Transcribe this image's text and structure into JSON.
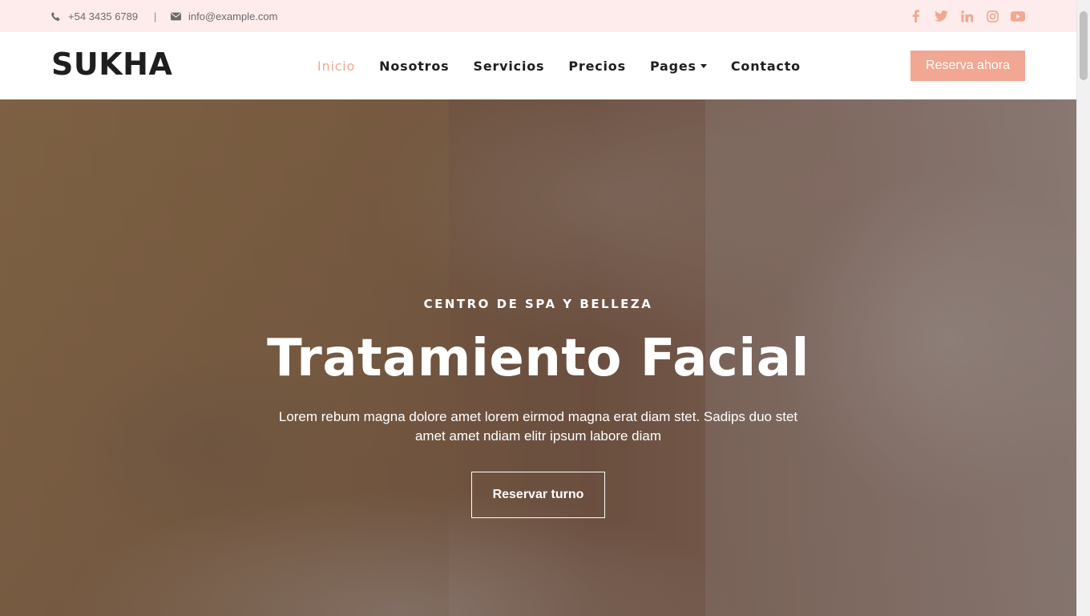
{
  "topbar": {
    "phone": "+54 3435 6789",
    "separator": "|",
    "email": "info@example.com",
    "phone_icon": "phone-icon",
    "email_icon": "envelope-icon",
    "socials": [
      "facebook-icon",
      "twitter-icon",
      "linkedin-icon",
      "instagram-icon",
      "youtube-icon"
    ],
    "accent": "#f2a793",
    "background": "#fdeceb"
  },
  "navbar": {
    "brand": "SUKHA",
    "items": [
      {
        "label": "Inicio",
        "active": true
      },
      {
        "label": "Nosotros"
      },
      {
        "label": "Servicios"
      },
      {
        "label": "Precios"
      },
      {
        "label": "Pages",
        "dropdown": true
      },
      {
        "label": "Contacto"
      }
    ],
    "cta": "Reserva ahora",
    "accent": "#f2a793"
  },
  "hero": {
    "kicker": "CENTRO DE SPA Y BELLEZA",
    "headline": "Tratamiento Facial",
    "lead": "Lorem rebum magna dolore amet lorem eirmod magna erat diam stet. Sadips duo stet amet amet ndiam elitr ipsum labore diam",
    "cta": "Reservar turno"
  }
}
